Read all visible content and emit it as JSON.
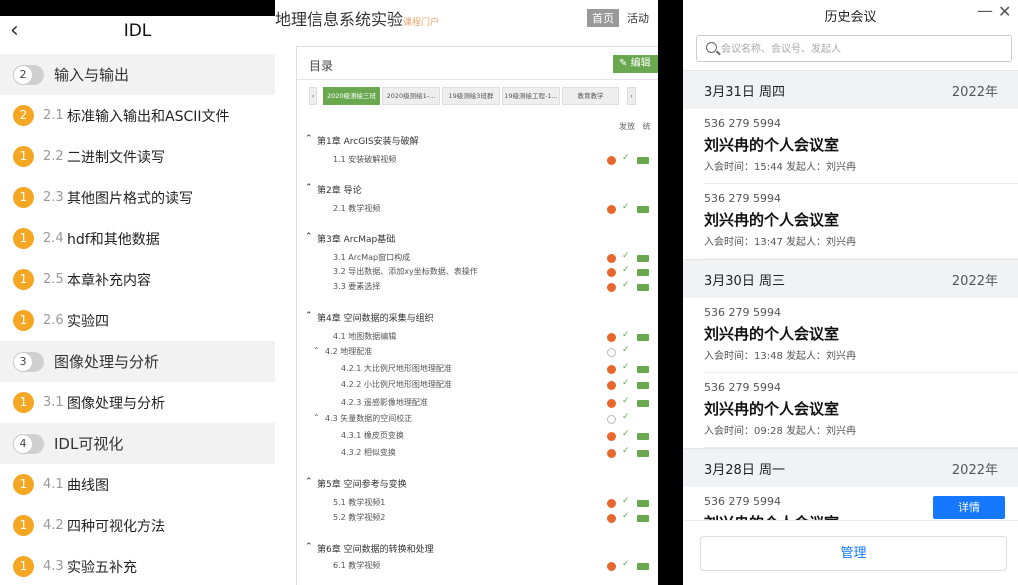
{
  "left": {
    "title": "IDL",
    "rows": [
      {
        "kind": "section",
        "badge": "2",
        "label": "输入与输出"
      },
      {
        "kind": "item",
        "badge": "2",
        "num": "2.1",
        "label": "标准输入输出和ASCII文件"
      },
      {
        "kind": "item",
        "badge": "1",
        "num": "2.2",
        "label": "二进制文件读写"
      },
      {
        "kind": "item",
        "badge": "1",
        "num": "2.3",
        "label": "其他图片格式的读写"
      },
      {
        "kind": "item",
        "badge": "1",
        "num": "2.4",
        "label": "hdf和其他数据"
      },
      {
        "kind": "item",
        "badge": "1",
        "num": "2.5",
        "label": "本章补充内容"
      },
      {
        "kind": "item",
        "badge": "1",
        "num": "2.6",
        "label": "实验四"
      },
      {
        "kind": "section",
        "badge": "3",
        "label": "图像处理与分析"
      },
      {
        "kind": "item",
        "badge": "1",
        "num": "3.1",
        "label": "图像处理与分析"
      },
      {
        "kind": "section",
        "badge": "4",
        "label": "IDL可视化"
      },
      {
        "kind": "item",
        "badge": "1",
        "num": "4.1",
        "label": "曲线图"
      },
      {
        "kind": "item",
        "badge": "1",
        "num": "4.2",
        "label": "四种可视化方法"
      },
      {
        "kind": "item",
        "badge": "1",
        "num": "4.3",
        "label": "实验五补充"
      }
    ]
  },
  "middle": {
    "brand": "地理信息系统实验",
    "brand_sub": "课程门户",
    "home": "首页",
    "activity": "活动",
    "catalog": "目录",
    "edit": "编辑",
    "tabs": [
      "2020级测绘三班",
      "2020级测绘1-...",
      "19级测绘3班群",
      "19级测绘工程-1...",
      "教育教学"
    ],
    "col_publish": "发放",
    "col_stats": "统",
    "lines": [
      {
        "t": "第1章 ArcGIS安装与破解",
        "lvl": 0,
        "st": ""
      },
      {
        "t": "1.1  安装破解视频",
        "lvl": 1,
        "st": "o"
      },
      {
        "t": "第2章 导论",
        "lvl": 0,
        "st": ""
      },
      {
        "t": "2.1  教学视频",
        "lvl": 1,
        "st": "o"
      },
      {
        "t": "第3章 ArcMap基础",
        "lvl": 0,
        "st": ""
      },
      {
        "t": "3.1  ArcMap窗口构成",
        "lvl": 1,
        "st": "o"
      },
      {
        "t": "3.2  导出数据、添加xy坐标数据、表操作",
        "lvl": 1,
        "st": "o"
      },
      {
        "t": "3.3  要素选择",
        "lvl": 1,
        "st": "o"
      },
      {
        "t": "第4章 空间数据的采集与组织",
        "lvl": 0,
        "st": ""
      },
      {
        "t": "4.1  地图数据编辑",
        "lvl": 1,
        "st": "o"
      },
      {
        "t": "4.2  地理配准",
        "lvl": 2,
        "st": "e"
      },
      {
        "t": "4.2.1  大比例尺地形图地理配准",
        "lvl": 3,
        "st": "o"
      },
      {
        "t": "4.2.2  小比例尺地形图地理配准",
        "lvl": 3,
        "st": "o"
      },
      {
        "t": "4.2.3  遥感影像地理配准",
        "lvl": 3,
        "st": "o"
      },
      {
        "t": "4.3  矢量数据的空间校正",
        "lvl": 2,
        "st": "e"
      },
      {
        "t": "4.3.1  橡皮页变换",
        "lvl": 3,
        "st": "o"
      },
      {
        "t": "4.3.2  相似变换",
        "lvl": 3,
        "st": "o"
      },
      {
        "t": "第5章 空间参考与变换",
        "lvl": 0,
        "st": ""
      },
      {
        "t": "5.1  教学视频1",
        "lvl": 1,
        "st": "o"
      },
      {
        "t": "5.2  教学视频2",
        "lvl": 1,
        "st": "o"
      },
      {
        "t": "第6章 空间数据的转换和处理",
        "lvl": 0,
        "st": ""
      },
      {
        "t": "6.1  教学视频",
        "lvl": 1,
        "st": "o"
      }
    ]
  },
  "right": {
    "title": "历史会议",
    "minimize": "—",
    "close": "✕",
    "search_placeholder": "会议名称、会议号、发起人",
    "groups": [
      {
        "date": "3月31日 周四",
        "year": "2022年",
        "meetings": [
          {
            "id": "536 279 5994",
            "name": "刘兴冉的个人会议室",
            "info": "入会时间：15:44   发起人：刘兴冉"
          },
          {
            "id": "536 279 5994",
            "name": "刘兴冉的个人会议室",
            "info": "入会时间：13:47   发起人：刘兴冉"
          }
        ]
      },
      {
        "date": "3月30日 周三",
        "year": "2022年",
        "meetings": [
          {
            "id": "536 279 5994",
            "name": "刘兴冉的个人会议室",
            "info": "入会时间：13:48   发起人：刘兴冉"
          },
          {
            "id": "536 279 5994",
            "name": "刘兴冉的个人会议室",
            "info": "入会时间：09:28   发起人：刘兴冉"
          }
        ]
      },
      {
        "date": "3月28日 周一",
        "year": "2022年",
        "meetings": [
          {
            "id": "536 279 5994",
            "name": "刘兴冉的个人会议室",
            "info": ""
          }
        ]
      }
    ],
    "detail": "详情",
    "manage": "管理"
  }
}
